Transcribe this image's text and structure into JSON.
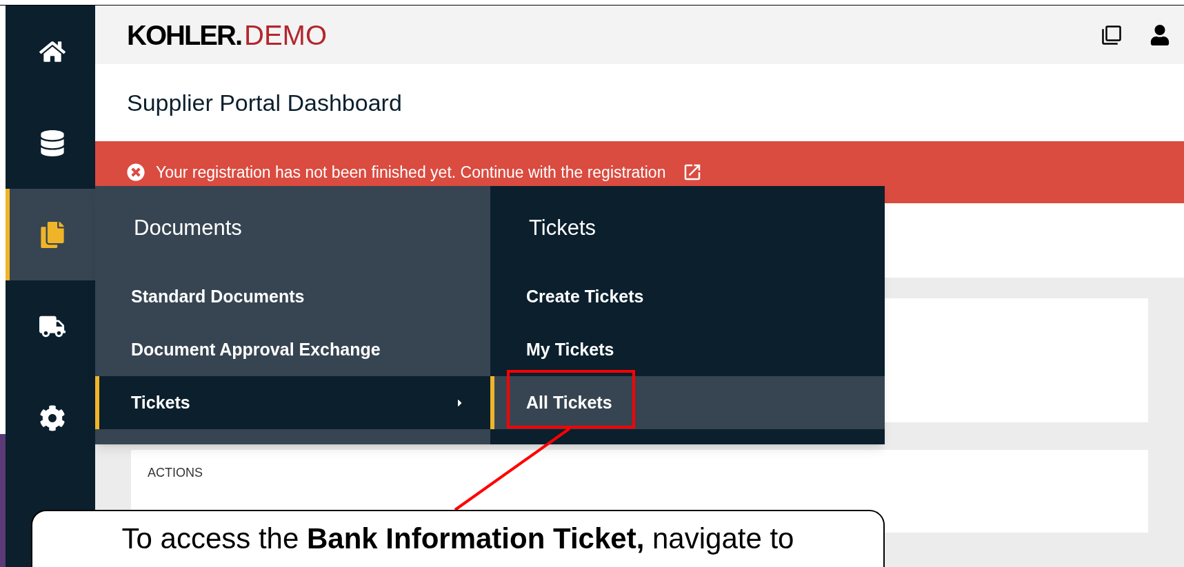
{
  "sidebar": {
    "items": [
      {
        "selected": false
      },
      {
        "selected": false
      },
      {
        "selected": true
      },
      {
        "selected": false
      },
      {
        "selected": false
      }
    ]
  },
  "header": {
    "logo_bold": "KOHLER.",
    "logo_light": "DEMO"
  },
  "page_title": "Supplier Portal Dashboard",
  "alert": {
    "text": "Your registration has not been finished yet. Continue with the registration"
  },
  "cards": [
    {
      "title": "ACTIONS"
    }
  ],
  "menu": {
    "columns": [
      {
        "title": "Documents",
        "items": [
          {
            "label": "Standard Documents",
            "selected": false,
            "kind": "link"
          },
          {
            "label": "Document Approval Exchange",
            "selected": false,
            "kind": "link"
          },
          {
            "label": "Tickets",
            "selected": true,
            "kind": "submenu"
          }
        ]
      },
      {
        "title": "Tickets",
        "items": [
          {
            "label": "Create Tickets",
            "selected": false,
            "kind": "link"
          },
          {
            "label": "My Tickets",
            "selected": false,
            "kind": "link"
          },
          {
            "label": "All Tickets",
            "selected": true,
            "kind": "link"
          }
        ]
      }
    ]
  },
  "callout": {
    "text": "To access the **Bank Information Ticket,** navigate to"
  }
}
